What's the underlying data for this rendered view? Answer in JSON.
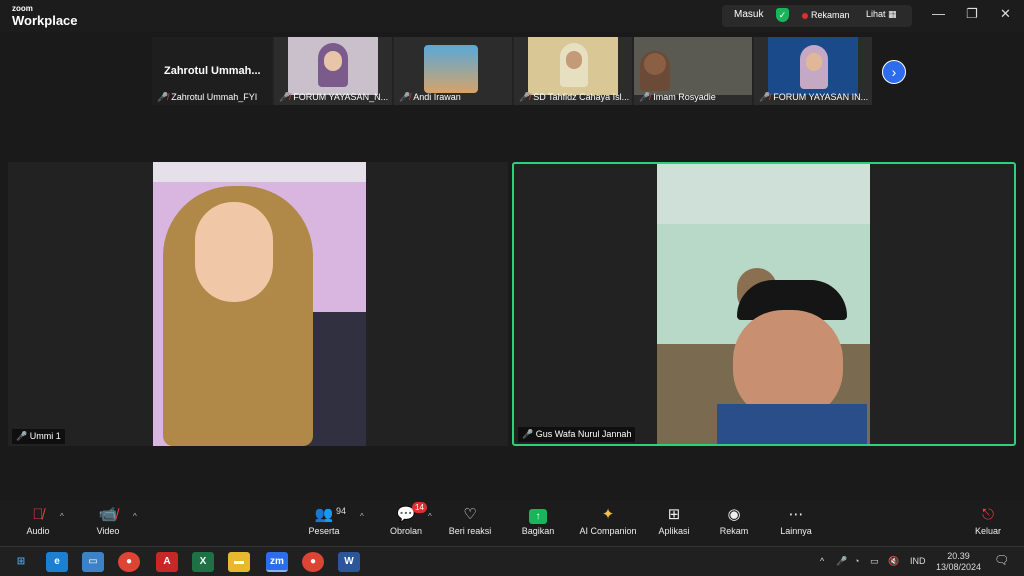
{
  "app": {
    "brand_small": "zoom",
    "brand_big": "Workplace"
  },
  "titlebar": {
    "masuk": "Masuk",
    "rekaman": "Rekaman",
    "lihat": "Lihat"
  },
  "strip": {
    "featured": "Zahrotul  Ummah...",
    "tiles": [
      {
        "name": "Zahrotul Ummah_FYI"
      },
      {
        "name": "FORUM YAYASAN_N..."
      },
      {
        "name": "Andi Irawan"
      },
      {
        "name": "SD Tahfidz Cahaya Isl..."
      },
      {
        "name": "Imam Rosyadie"
      },
      {
        "name": "FORUM YAYASAN IN..."
      }
    ]
  },
  "videos": {
    "left_name": "Ummi 1",
    "right_name": "Gus Wafa Nurul Jannah"
  },
  "toolbar": {
    "audio": "Audio",
    "video": "Video",
    "peserta": "Peserta",
    "peserta_count": "94",
    "obrolan": "Obrolan",
    "obrolan_badge": "14",
    "beri_reaksi": "Beri reaksi",
    "bagikan": "Bagikan",
    "ai_companion": "AI Companion",
    "aplikasi": "Aplikasi",
    "rekam": "Rekam",
    "lainnya": "Lainnya",
    "keluar": "Keluar"
  },
  "taskbar": {
    "lang": "IND",
    "time": "20.39",
    "date": "13/08/2024"
  },
  "colors": {
    "active_speaker": "#2fd07b",
    "share": "#19b55b",
    "mute": "#e84141",
    "accent": "#2d6ced"
  }
}
